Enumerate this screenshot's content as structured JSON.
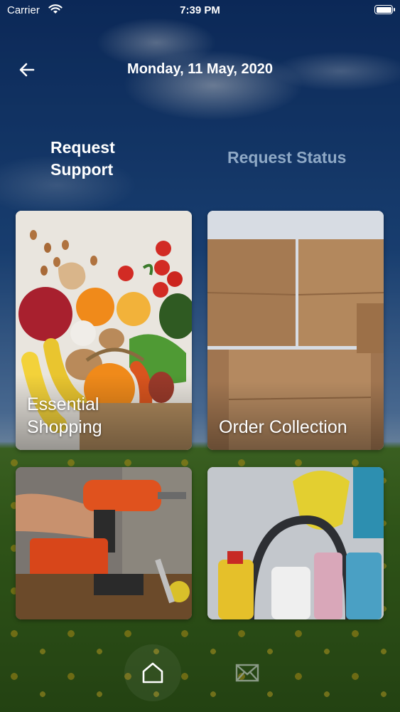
{
  "status_bar": {
    "carrier": "Carrier",
    "time": "7:39 PM"
  },
  "nav": {
    "title": "Monday, 11 May, 2020",
    "back_icon": "arrow-left-icon"
  },
  "tabs": {
    "request_support": "Request\nSupport",
    "request_status": "Request Status",
    "active": "request_support"
  },
  "cards": [
    {
      "label": "Essential\nShopping",
      "image": "groceries-photo"
    },
    {
      "label": "Order Collection",
      "image": "cardboard-boxes-photo"
    },
    {
      "label": "",
      "image": "power-drill-tools-photo"
    },
    {
      "label": "",
      "image": "cleaning-supplies-photo"
    }
  ],
  "tab_bar": {
    "home_icon": "home-icon",
    "mail_icon": "mail-icon",
    "active": "home"
  },
  "colors": {
    "active_tab_text": "#ffffff",
    "inactive_tab_text": "#8fa9c6"
  }
}
